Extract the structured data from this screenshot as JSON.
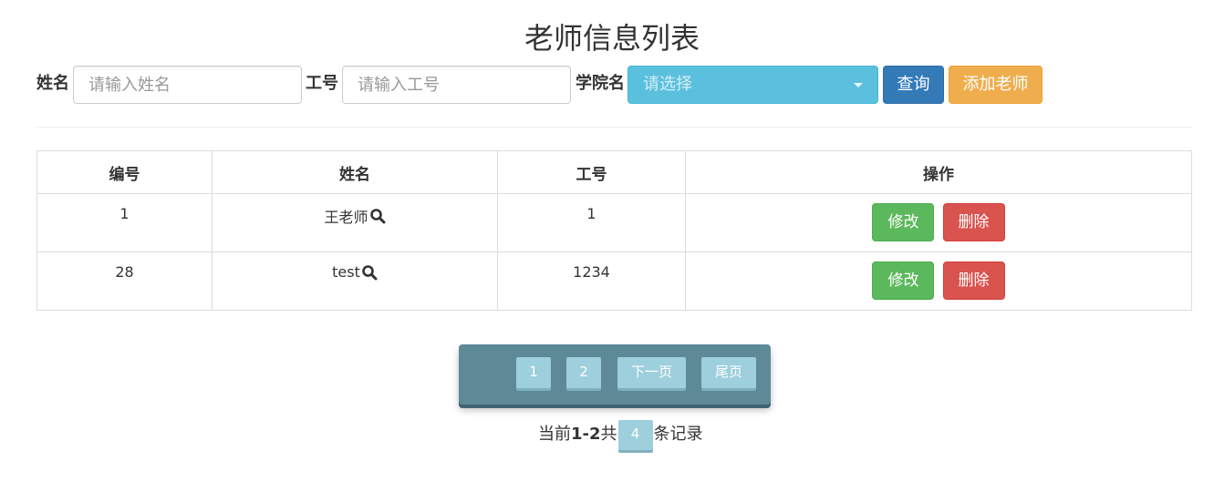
{
  "page": {
    "title": "老师信息列表"
  },
  "search": {
    "name_label": "姓名",
    "name_placeholder": "请输入姓名",
    "name_value": "",
    "jobno_label": "工号",
    "jobno_placeholder": "请输入工号",
    "jobno_value": "",
    "college_label": "学院名",
    "college_selected": "请选择",
    "query_label": "查询",
    "add_label": "添加老师"
  },
  "table": {
    "headers": [
      "编号",
      "姓名",
      "工号",
      "操作"
    ],
    "rows": [
      {
        "id": "1",
        "name": "王老师",
        "jobno": "1",
        "edit": "修改",
        "delete": "删除"
      },
      {
        "id": "28",
        "name": "test",
        "jobno": "1234",
        "edit": "修改",
        "delete": "删除"
      }
    ]
  },
  "pager": {
    "pages": [
      "1",
      "2"
    ],
    "next_label": "下一页",
    "last_label": "尾页"
  },
  "records": {
    "prefix": "当前",
    "range": "1-2",
    "total_prefix": "共",
    "total": "4",
    "suffix": "条记录"
  },
  "colors": {
    "primary": "#337ab7",
    "warning": "#f0ad4e",
    "info": "#5bc0de",
    "success": "#5cb85c",
    "danger": "#d9534f",
    "pager_bg": "#5e8a98",
    "pager_btn": "#9ecfdc"
  },
  "icons": {
    "name_search": "magnifier-icon",
    "select_caret": "caret-down-icon"
  }
}
